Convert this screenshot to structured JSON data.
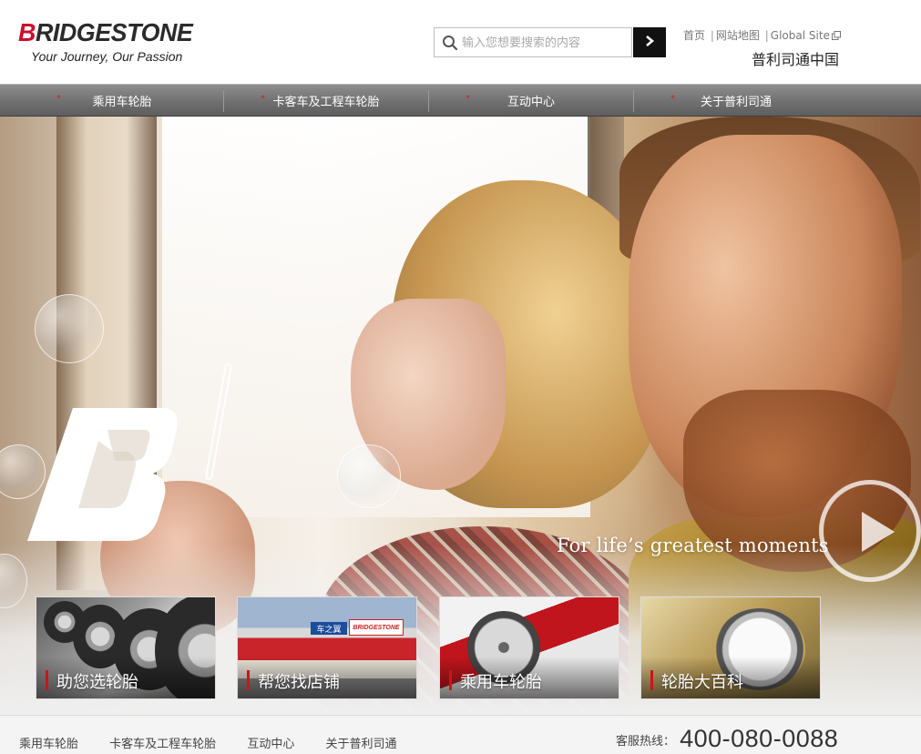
{
  "brand": {
    "wordmark": "BRIDGESTONE",
    "tagline": "Your Journey, Our Passion",
    "chinese_name": "普利司通中国",
    "color_red": "#c8102e"
  },
  "search": {
    "placeholder": "输入您想要搜索的内容",
    "icon": "search-icon",
    "submit_icon": "chevron-right-icon"
  },
  "toplinks": {
    "home": "首页",
    "sitemap": "网站地图",
    "global": "Global Site",
    "separator": "|"
  },
  "nav": {
    "items": [
      {
        "label": "乘用车轮胎"
      },
      {
        "label": "卡客车及工程车轮胎"
      },
      {
        "label": "互动中心"
      },
      {
        "label": "关于普利司通"
      }
    ],
    "marker": "*"
  },
  "hero": {
    "tagline": "For life’s greatest moments",
    "play_icon": "play-icon",
    "logo_mark": "B"
  },
  "tiles": [
    {
      "label": "助您选轮胎"
    },
    {
      "label": "帮您找店铺"
    },
    {
      "label": "乘用车轮胎"
    },
    {
      "label": "轮胎大百科"
    }
  ],
  "tile_details": {
    "shop_sign": "车之翼",
    "shop_brand": "BRIDGESTONE"
  },
  "footer": {
    "links": [
      {
        "label": "乘用车轮胎"
      },
      {
        "label": "卡客车及工程车轮胎"
      },
      {
        "label": "互动中心"
      },
      {
        "label": "关于普利司通"
      }
    ],
    "hotline_label": "客服热线：",
    "hotline_number": "400-080-0088"
  }
}
